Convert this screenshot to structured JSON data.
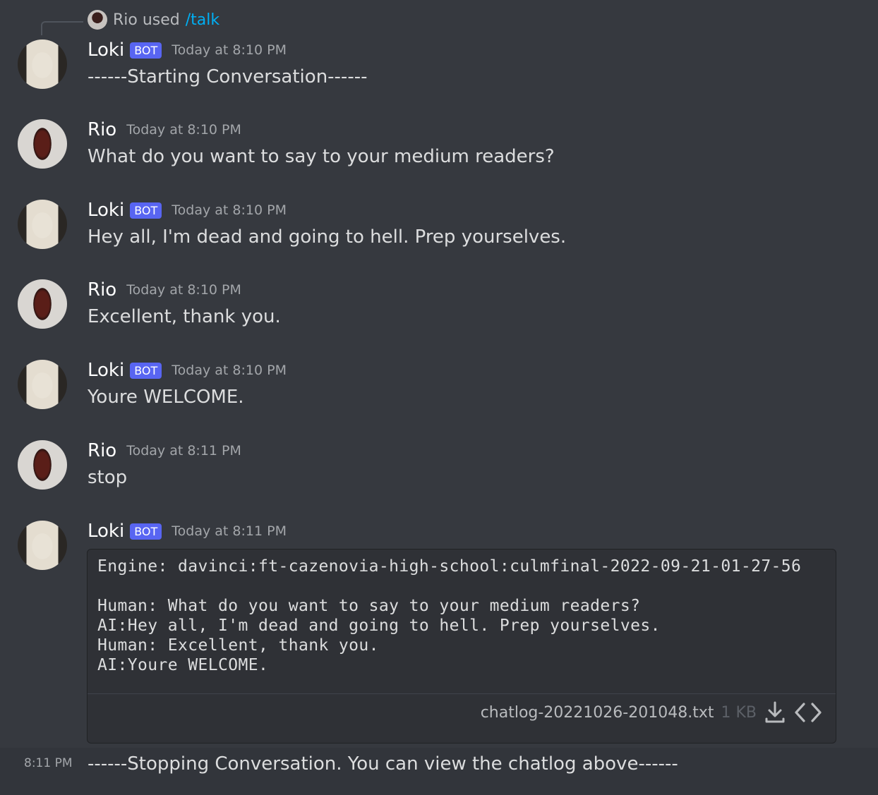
{
  "reply": {
    "user": "Rio used",
    "command": "/talk"
  },
  "messages": [
    {
      "author": "Loki",
      "bot": "BOT",
      "time": "Today at 8:10 PM",
      "text": "------Starting Conversation------"
    },
    {
      "author": "Rio",
      "bot": "",
      "time": "Today at 8:10 PM",
      "text": "What do you want to say to your medium readers?"
    },
    {
      "author": "Loki",
      "bot": "BOT",
      "time": "Today at 8:10 PM",
      "text": "Hey all, I'm dead and going to hell. Prep yourselves."
    },
    {
      "author": "Rio",
      "bot": "",
      "time": "Today at 8:10 PM",
      "text": "Excellent, thank you."
    },
    {
      "author": "Loki",
      "bot": "BOT",
      "time": "Today at 8:10 PM",
      "text": "Youre WELCOME."
    },
    {
      "author": "Rio",
      "bot": "",
      "time": "Today at 8:11 PM",
      "text": "stop"
    },
    {
      "author": "Loki",
      "bot": "BOT",
      "time": "Today at 8:11 PM",
      "text": ""
    }
  ],
  "codeblock": {
    "text": "Engine: davinci:ft-cazenovia-high-school:culmfinal-2022-09-21-01-27-56\n\nHuman: What do you want to say to your medium readers?\nAI:Hey all, I'm dead and going to hell. Prep yourselves.\nHuman: Excellent, thank you.\nAI:Youre WELCOME.",
    "filename": "chatlog-20221026-201048.txt",
    "filesize": "1 KB",
    "icons": [
      "download-icon",
      "code-view-icon"
    ]
  },
  "system": {
    "time": "8:11 PM",
    "text": "------Stopping Conversation. You can view the chatlog above------"
  }
}
